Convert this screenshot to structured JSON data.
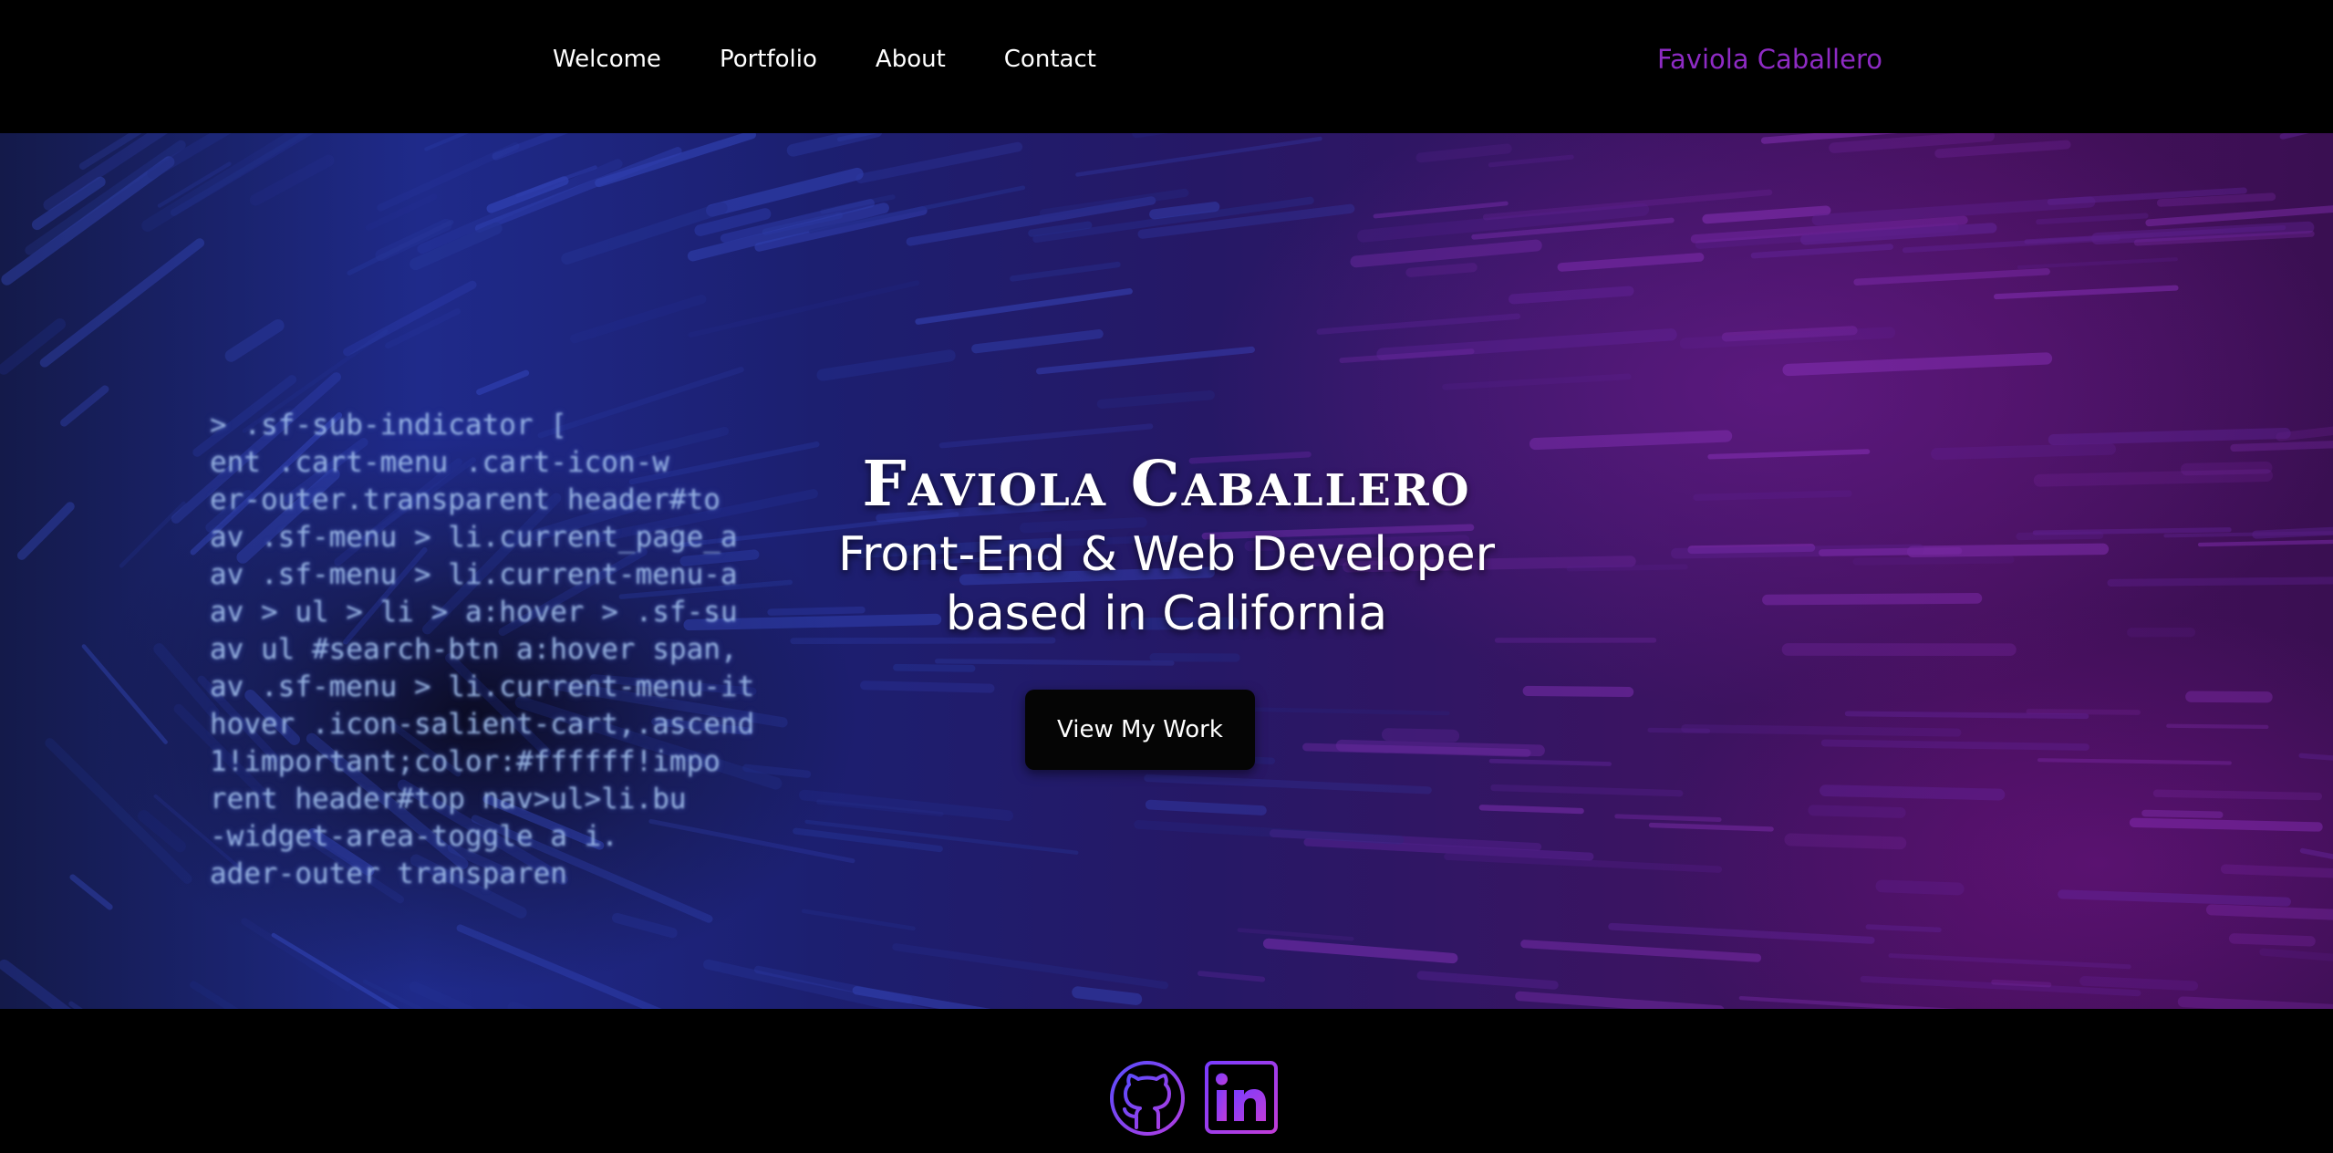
{
  "nav": {
    "items": [
      {
        "label": "Welcome"
      },
      {
        "label": "Portfolio"
      },
      {
        "label": "About"
      },
      {
        "label": "Contact"
      }
    ],
    "brand": "Faviola Caballero",
    "brand_color": "#8e2bc4"
  },
  "hero": {
    "title": "Faviola Caballero",
    "subtitle_line1": "Front-End & Web Developer",
    "subtitle_line2": "based in California",
    "cta_label": "View My Work",
    "background_code": [
      "> .sf-sub-indicator [",
      "ent .cart-menu .cart-icon-w",
      "er-outer.transparent header#to",
      "av .sf-menu > li.current_page_a",
      "av .sf-menu > li.current-menu-a",
      "av > ul > li > a:hover > .sf-su",
      "av ul #search-btn a:hover span,",
      "av .sf-menu > li.current-menu-it",
      "hover .icon-salient-cart,.ascend",
      "1!important;color:#ffffff!impo",
      "rent header#top nav>ul>li.bu",
      "-widget-area-toggle a i.",
      "ader-outer transparen"
    ]
  },
  "footer": {
    "icons": [
      {
        "name": "github-icon"
      },
      {
        "name": "linkedin-icon"
      }
    ],
    "icon_gradient": [
      "#7a3cff",
      "#b43cdc"
    ]
  }
}
